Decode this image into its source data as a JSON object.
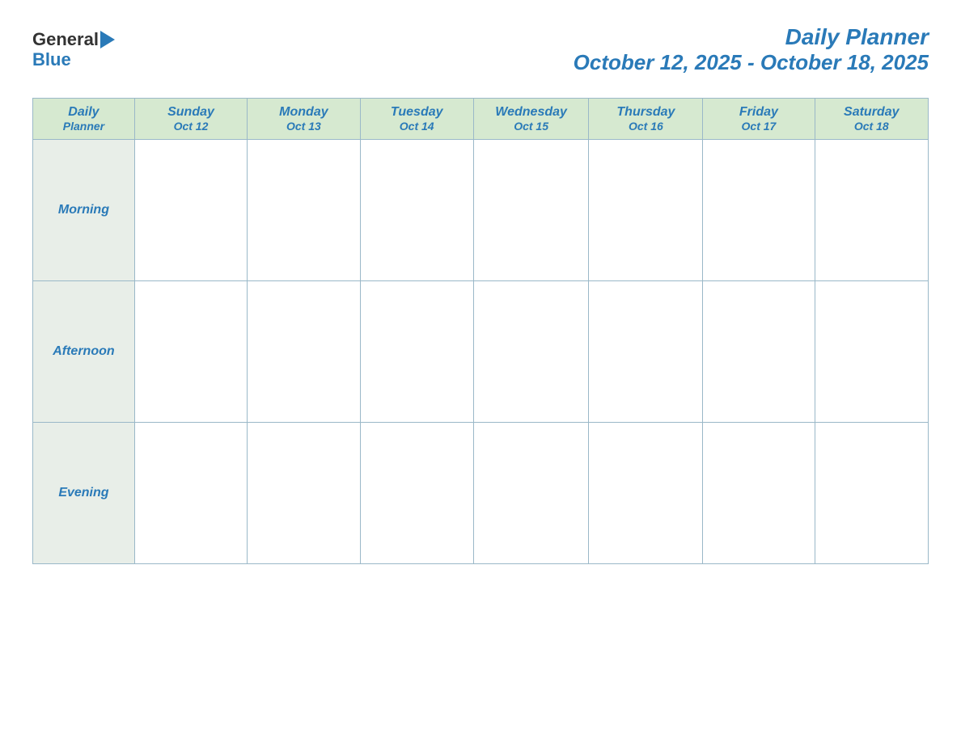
{
  "logo": {
    "general": "General",
    "blue": "Blue"
  },
  "header": {
    "title": "Daily Planner",
    "subtitle": "October 12, 2025 - October 18, 2025"
  },
  "columns": [
    {
      "day": "Daily",
      "secondary": "Planner",
      "date": ""
    },
    {
      "day": "Sunday",
      "secondary": "",
      "date": "Oct 12"
    },
    {
      "day": "Monday",
      "secondary": "",
      "date": "Oct 13"
    },
    {
      "day": "Tuesday",
      "secondary": "",
      "date": "Oct 14"
    },
    {
      "day": "Wednesday",
      "secondary": "",
      "date": "Oct 15"
    },
    {
      "day": "Thursday",
      "secondary": "",
      "date": "Oct 16"
    },
    {
      "day": "Friday",
      "secondary": "",
      "date": "Oct 17"
    },
    {
      "day": "Saturday",
      "secondary": "",
      "date": "Oct 18"
    }
  ],
  "rows": [
    {
      "label": "Morning"
    },
    {
      "label": "Afternoon"
    },
    {
      "label": "Evening"
    }
  ]
}
